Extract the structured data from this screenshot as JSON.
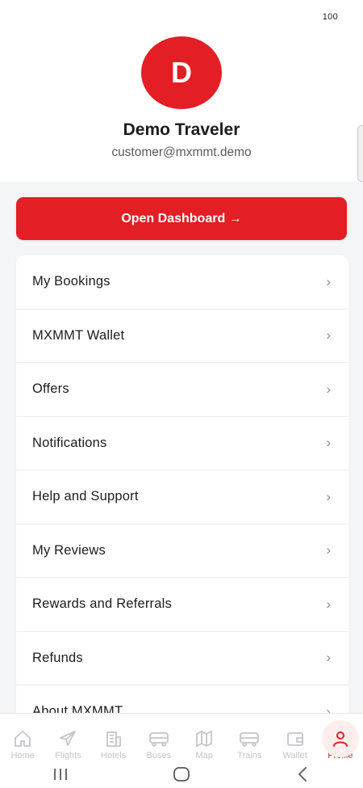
{
  "status_bar": {
    "battery": "100"
  },
  "profile": {
    "avatar_initial": "D",
    "name": "Demo Traveler",
    "email": "customer@mxmmt.demo"
  },
  "dashboard_button": {
    "label": "Open Dashboard →"
  },
  "menu": {
    "chevron": "›",
    "items": [
      {
        "label": "My Bookings"
      },
      {
        "label": "MXMMT Wallet"
      },
      {
        "label": "Offers"
      },
      {
        "label": "Notifications"
      },
      {
        "label": "Help and Support"
      },
      {
        "label": "My Reviews"
      },
      {
        "label": "Rewards and Referrals"
      },
      {
        "label": "Refunds"
      },
      {
        "label": "About MXMMT"
      }
    ]
  },
  "bottom_nav": {
    "items": [
      {
        "label": "Home",
        "icon": "home-icon"
      },
      {
        "label": "Flights",
        "icon": "plane-icon"
      },
      {
        "label": "Hotels",
        "icon": "building-icon"
      },
      {
        "label": "Buses",
        "icon": "bus-icon"
      },
      {
        "label": "Map",
        "icon": "map-icon"
      },
      {
        "label": "Trains",
        "icon": "train-icon"
      },
      {
        "label": "Wallet",
        "icon": "wallet-icon"
      },
      {
        "label": "Profile",
        "icon": "user-icon",
        "active": true
      }
    ]
  },
  "colors": {
    "brand": "#e31e24",
    "inactive_icon": "#c4c4c9"
  }
}
